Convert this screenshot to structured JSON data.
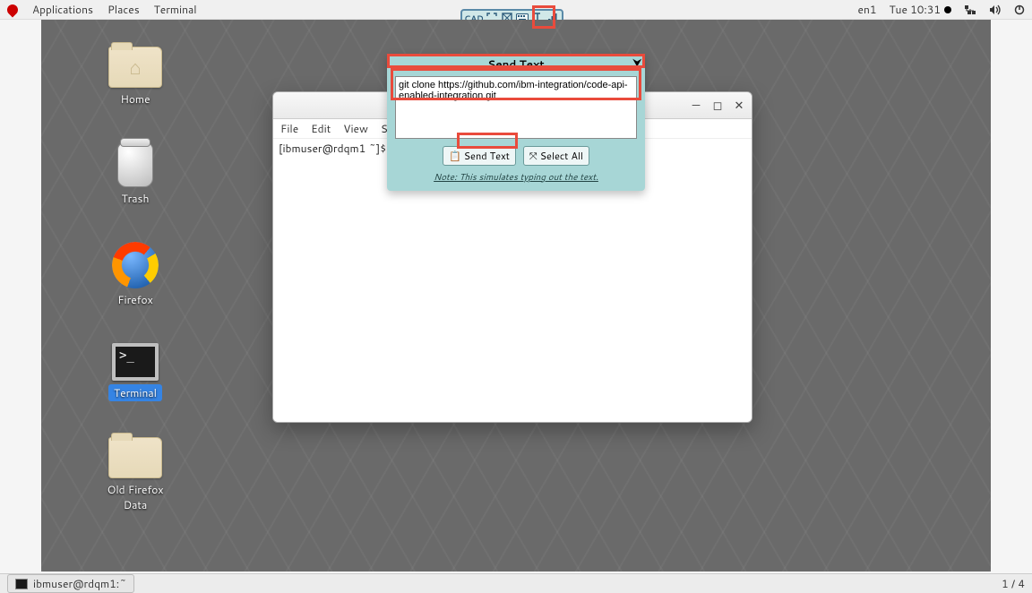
{
  "topbar": {
    "applications": "Applications",
    "places": "Places",
    "terminal": "Terminal",
    "lang": "en1",
    "clock": "Tue 10:31"
  },
  "vnc": {
    "cad": "CAD"
  },
  "desktop_icons": {
    "home": "Home",
    "trash": "Trash",
    "firefox": "Firefox",
    "terminal": "Terminal",
    "old_firefox": "Old Firefox Data"
  },
  "terminal_window": {
    "menu": {
      "file": "File",
      "edit": "Edit",
      "view": "View",
      "search": "Search"
    },
    "prompt": "[ibmuser@rdqm1 ~]$ "
  },
  "send_panel": {
    "title": "Send Text",
    "textarea_value": "git clone https://github.com/ibm-integration/code-api-enabled-integration.git",
    "send_label": "Send Text",
    "select_all_label": "Select All",
    "note": "Note: This simulates typing out the text."
  },
  "bottombar": {
    "task": "ibmuser@rdqm1:~",
    "workspace": "1 / 4"
  }
}
